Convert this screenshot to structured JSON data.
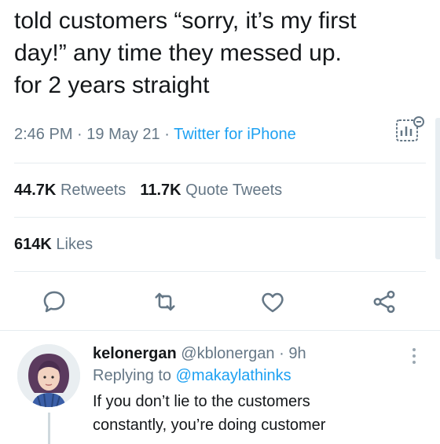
{
  "tweet": {
    "text_line1": "told customers “sorry, it’s my first",
    "text_line2": "day!” any time they messed up.",
    "text_line3": "for 2 years straight",
    "time": "2:46 PM",
    "dot1": " · ",
    "date": "19 May 21",
    "dot2": " · ",
    "source": "Twitter for iPhone"
  },
  "stats": {
    "retweets_count": "44.7K",
    "retweets_label": "Retweets",
    "quotes_count": "11.7K",
    "quotes_label": "Quote Tweets",
    "likes_count": "614K",
    "likes_label": "Likes"
  },
  "actions": {
    "icons": [
      "reply-icon",
      "retweet-icon",
      "like-icon",
      "share-icon"
    ]
  },
  "reply": {
    "name": "kelonergan",
    "handle": "@kblonergan",
    "separator": " · ",
    "time": "9h",
    "replying_prefix": "Replying to ",
    "replying_to": "@makaylathinks",
    "body_line1": "If you don’t lie to the customers",
    "body_line2": "constantly, you’re doing customer"
  },
  "colors": {
    "link": "#1da1f2",
    "secondary_text": "#657786",
    "primary_text": "#14171a",
    "divider": "#e6ecf0"
  }
}
